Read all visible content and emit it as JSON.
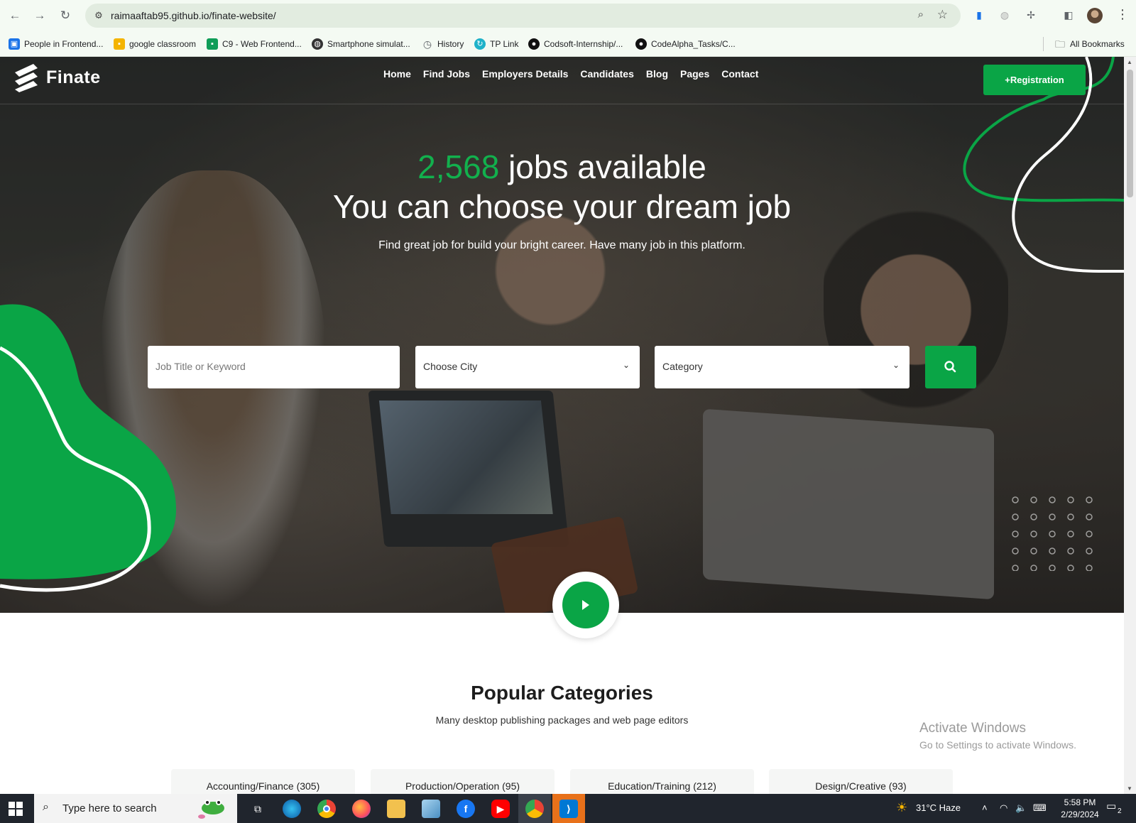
{
  "browser": {
    "url": "raimaaftab95.github.io/finate-website/",
    "bookmarks": [
      {
        "label": "People in Frontend...",
        "icon": "contact-card-icon",
        "color": "#1a73e8"
      },
      {
        "label": "google classroom",
        "icon": "classroom-icon",
        "color": "#f4b400"
      },
      {
        "label": "C9 - Web Frontend...",
        "icon": "chat-icon",
        "color": "#0f9d58"
      },
      {
        "label": "Smartphone simulat...",
        "icon": "globe-icon",
        "color": "#333333"
      },
      {
        "label": "History",
        "icon": "history-icon",
        "color": "#5f6368"
      },
      {
        "label": "TP Link",
        "icon": "tplink-icon",
        "color": "#1fb2c9"
      },
      {
        "label": "Codsoft-Internship/...",
        "icon": "github-icon",
        "color": "#111111"
      },
      {
        "label": "CodeAlpha_Tasks/C...",
        "icon": "github-icon",
        "color": "#111111"
      }
    ],
    "all_bookmarks": "All Bookmarks"
  },
  "site": {
    "brand": "Finate",
    "nav": [
      "Home",
      "Find Jobs",
      "Employers Details",
      "Candidates",
      "Blog",
      "Pages",
      "Contact"
    ],
    "register_button": "+Registration",
    "hero": {
      "count": "2,568",
      "line1_rest": " jobs available",
      "line2": "You can choose your dream job",
      "subtitle": "Find great job for build your bright career. Have many job in this platform."
    },
    "search": {
      "keyword_placeholder": "Job Title or Keyword",
      "city_value": "Choose City",
      "category_value": "Category"
    },
    "categories": {
      "title": "Popular Categories",
      "subtitle": "Many desktop publishing packages and web page editors",
      "items": [
        "Accounting/Finance (305)",
        "Production/Operation (95)",
        "Education/Training (212)",
        "Design/Creative (93)"
      ]
    },
    "colors": {
      "accent": "#0aa546",
      "accent_text": "#12b04d"
    }
  },
  "watermark": {
    "line1": "Activate Windows",
    "line2": "Go to Settings to activate Windows."
  },
  "taskbar": {
    "search_placeholder": "Type here to search",
    "weather": "31°C  Haze",
    "time": "5:58 PM",
    "date": "2/29/2024",
    "notifications": "2",
    "apps": [
      "task-view-icon",
      "edge-icon",
      "chrome-icon",
      "firefox-icon",
      "file-explorer-icon",
      "notepad-icon",
      "facebook-icon",
      "youtube-icon",
      "chrome-profile-icon",
      "vscode-icon"
    ]
  }
}
